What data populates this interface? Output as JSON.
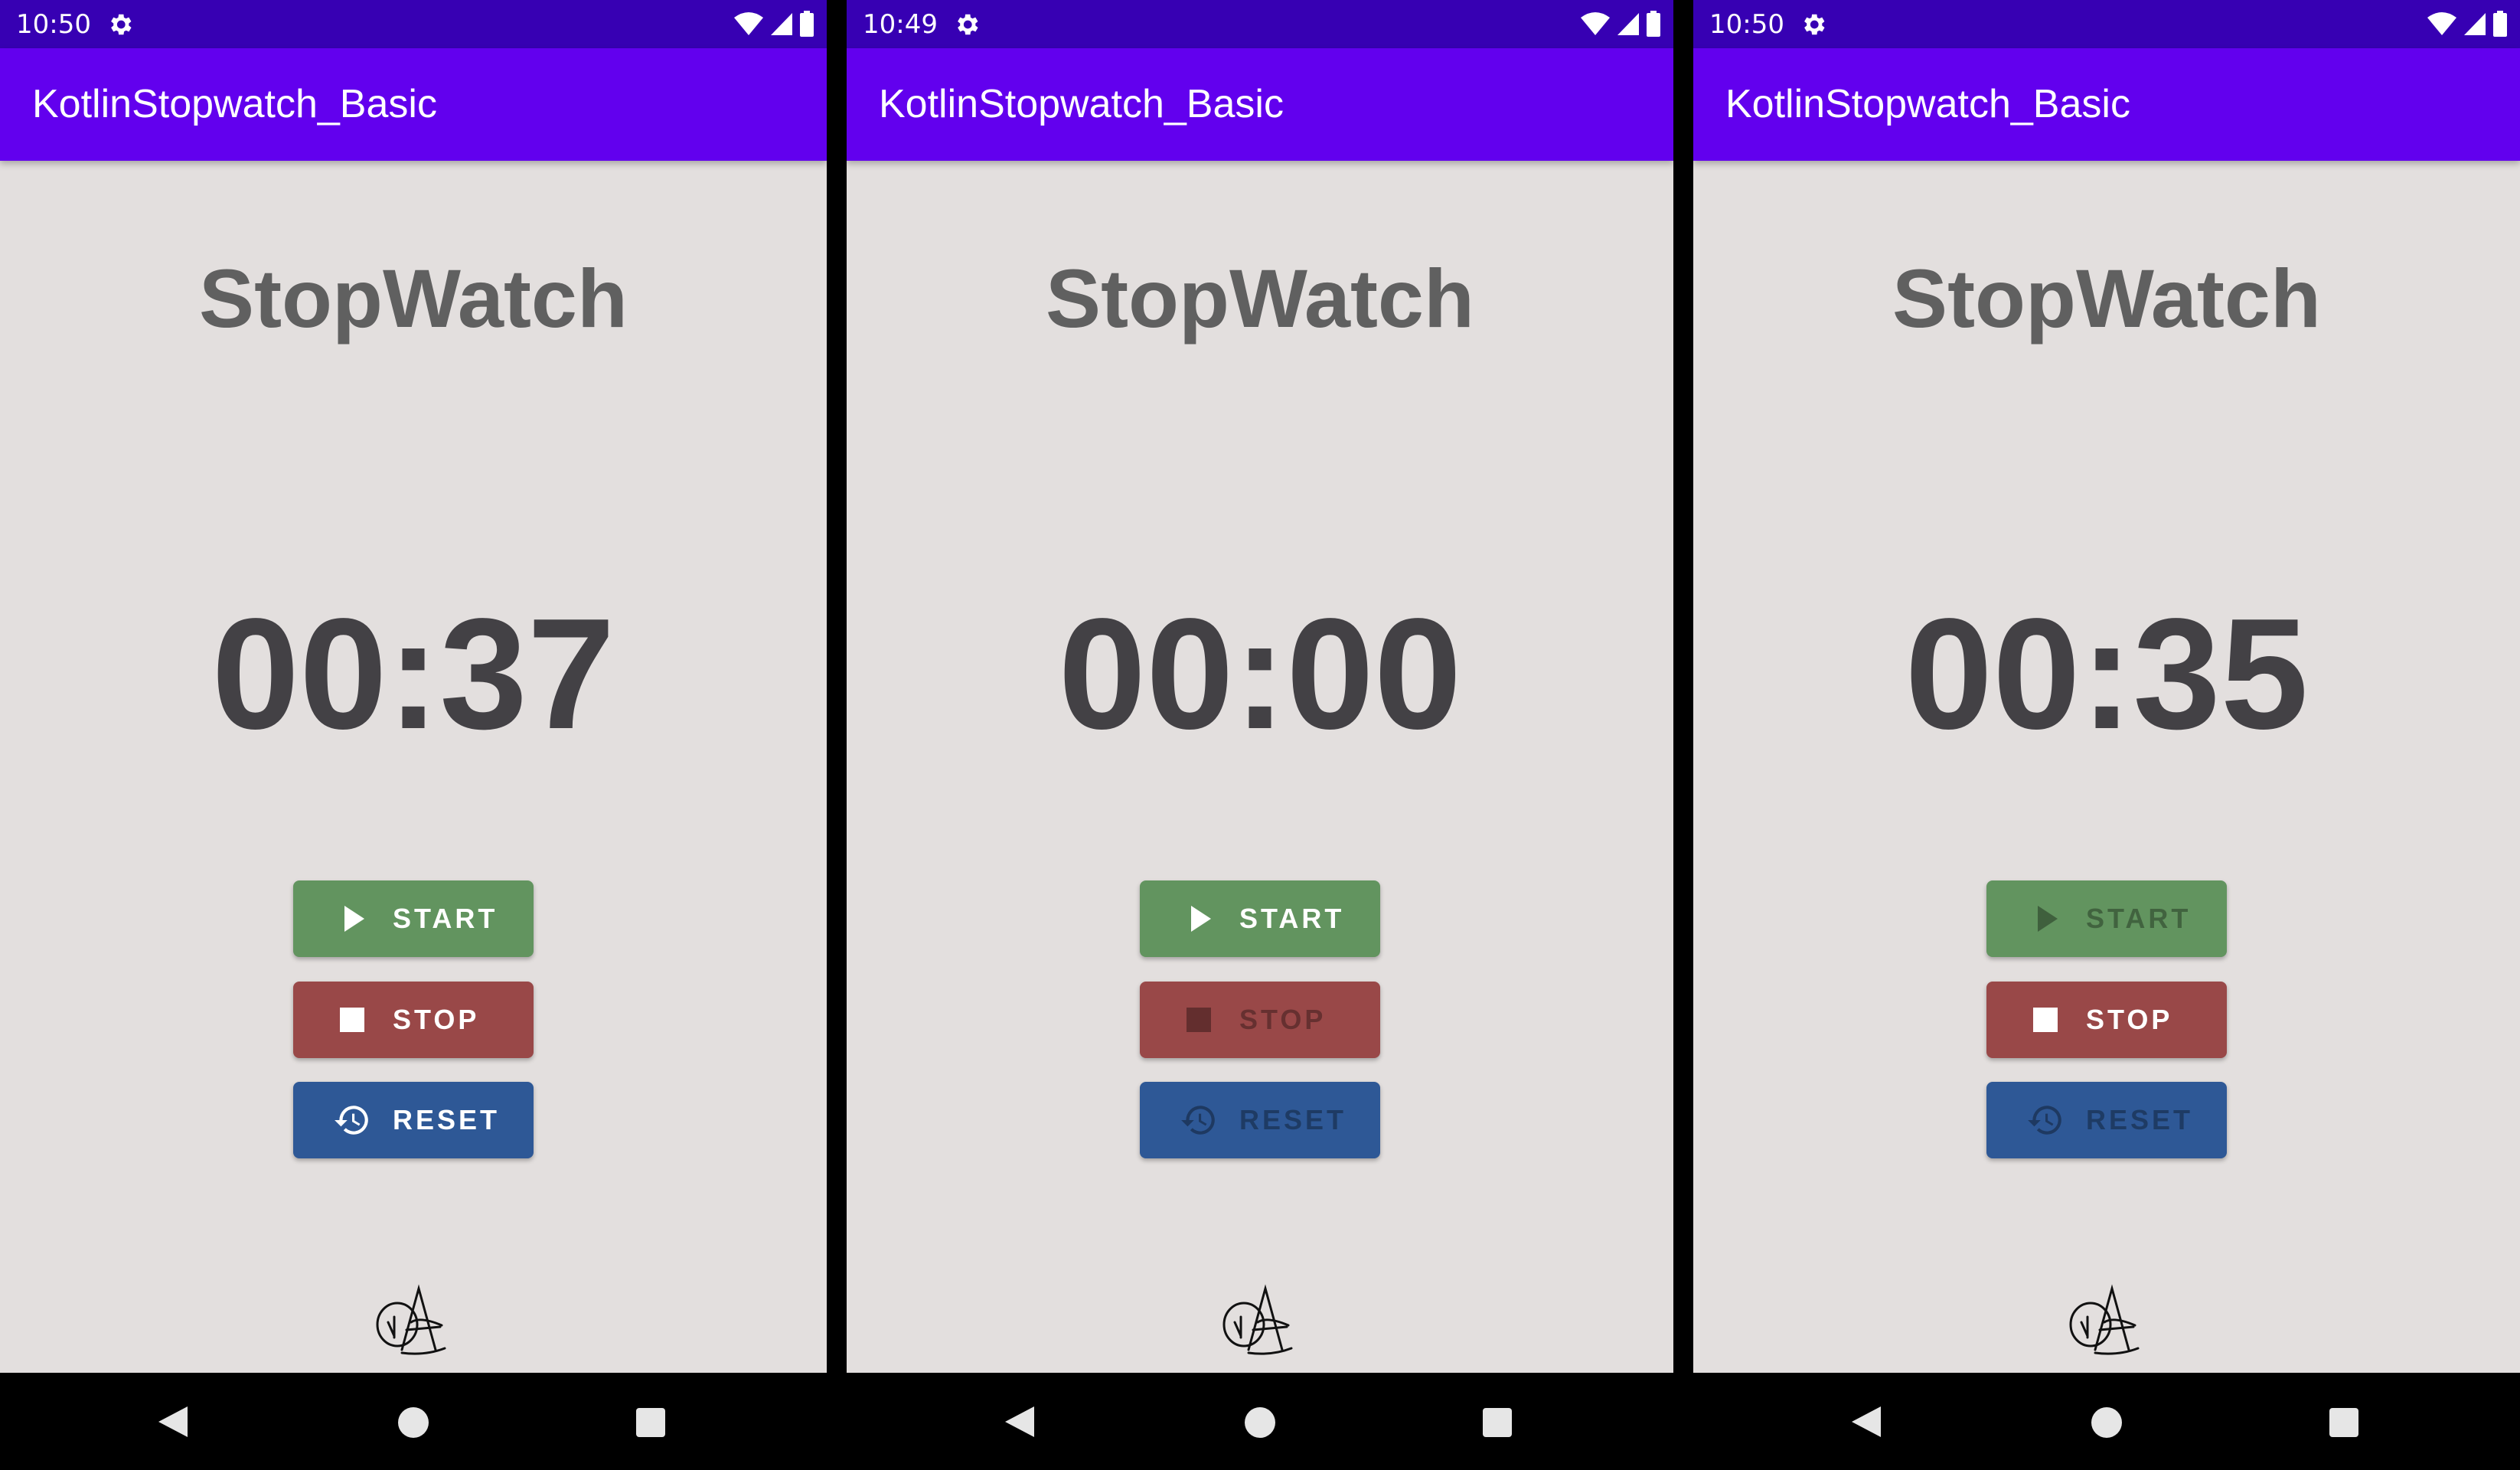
{
  "screens": [
    {
      "status_time": "10:50",
      "app_title": "KotlinStopwatch_Basic",
      "heading": "StopWatch",
      "timer": "00:37",
      "buttons": {
        "start": "START",
        "stop": "STOP",
        "reset": "RESET"
      },
      "button_state": {
        "start": "enabled",
        "stop": "enabled",
        "reset": "enabled"
      }
    },
    {
      "status_time": "10:49",
      "app_title": "KotlinStopwatch_Basic",
      "heading": "StopWatch",
      "timer": "00:00",
      "buttons": {
        "start": "START",
        "stop": "STOP",
        "reset": "RESET"
      },
      "button_state": {
        "start": "enabled",
        "stop": "disabled",
        "reset": "disabled"
      }
    },
    {
      "status_time": "10:50",
      "app_title": "KotlinStopwatch_Basic",
      "heading": "StopWatch",
      "timer": "00:35",
      "buttons": {
        "start": "START",
        "stop": "STOP",
        "reset": "RESET"
      },
      "button_state": {
        "start": "disabled",
        "stop": "enabled",
        "reset": "disabled"
      }
    }
  ],
  "colors": {
    "status_bar": "#3700b3",
    "app_bar": "#6200ee",
    "background": "#e3dfde",
    "start_button": "#62945f",
    "stop_button": "#994848",
    "reset_button": "#2e5896"
  },
  "icons": {
    "status": [
      "gear-icon",
      "wifi-icon",
      "cell-signal-icon",
      "battery-icon"
    ],
    "buttons": {
      "start": "play-icon",
      "stop": "stop-square-icon",
      "reset": "history-icon"
    },
    "nav": [
      "nav-back-icon",
      "nav-home-icon",
      "nav-recents-icon"
    ]
  }
}
